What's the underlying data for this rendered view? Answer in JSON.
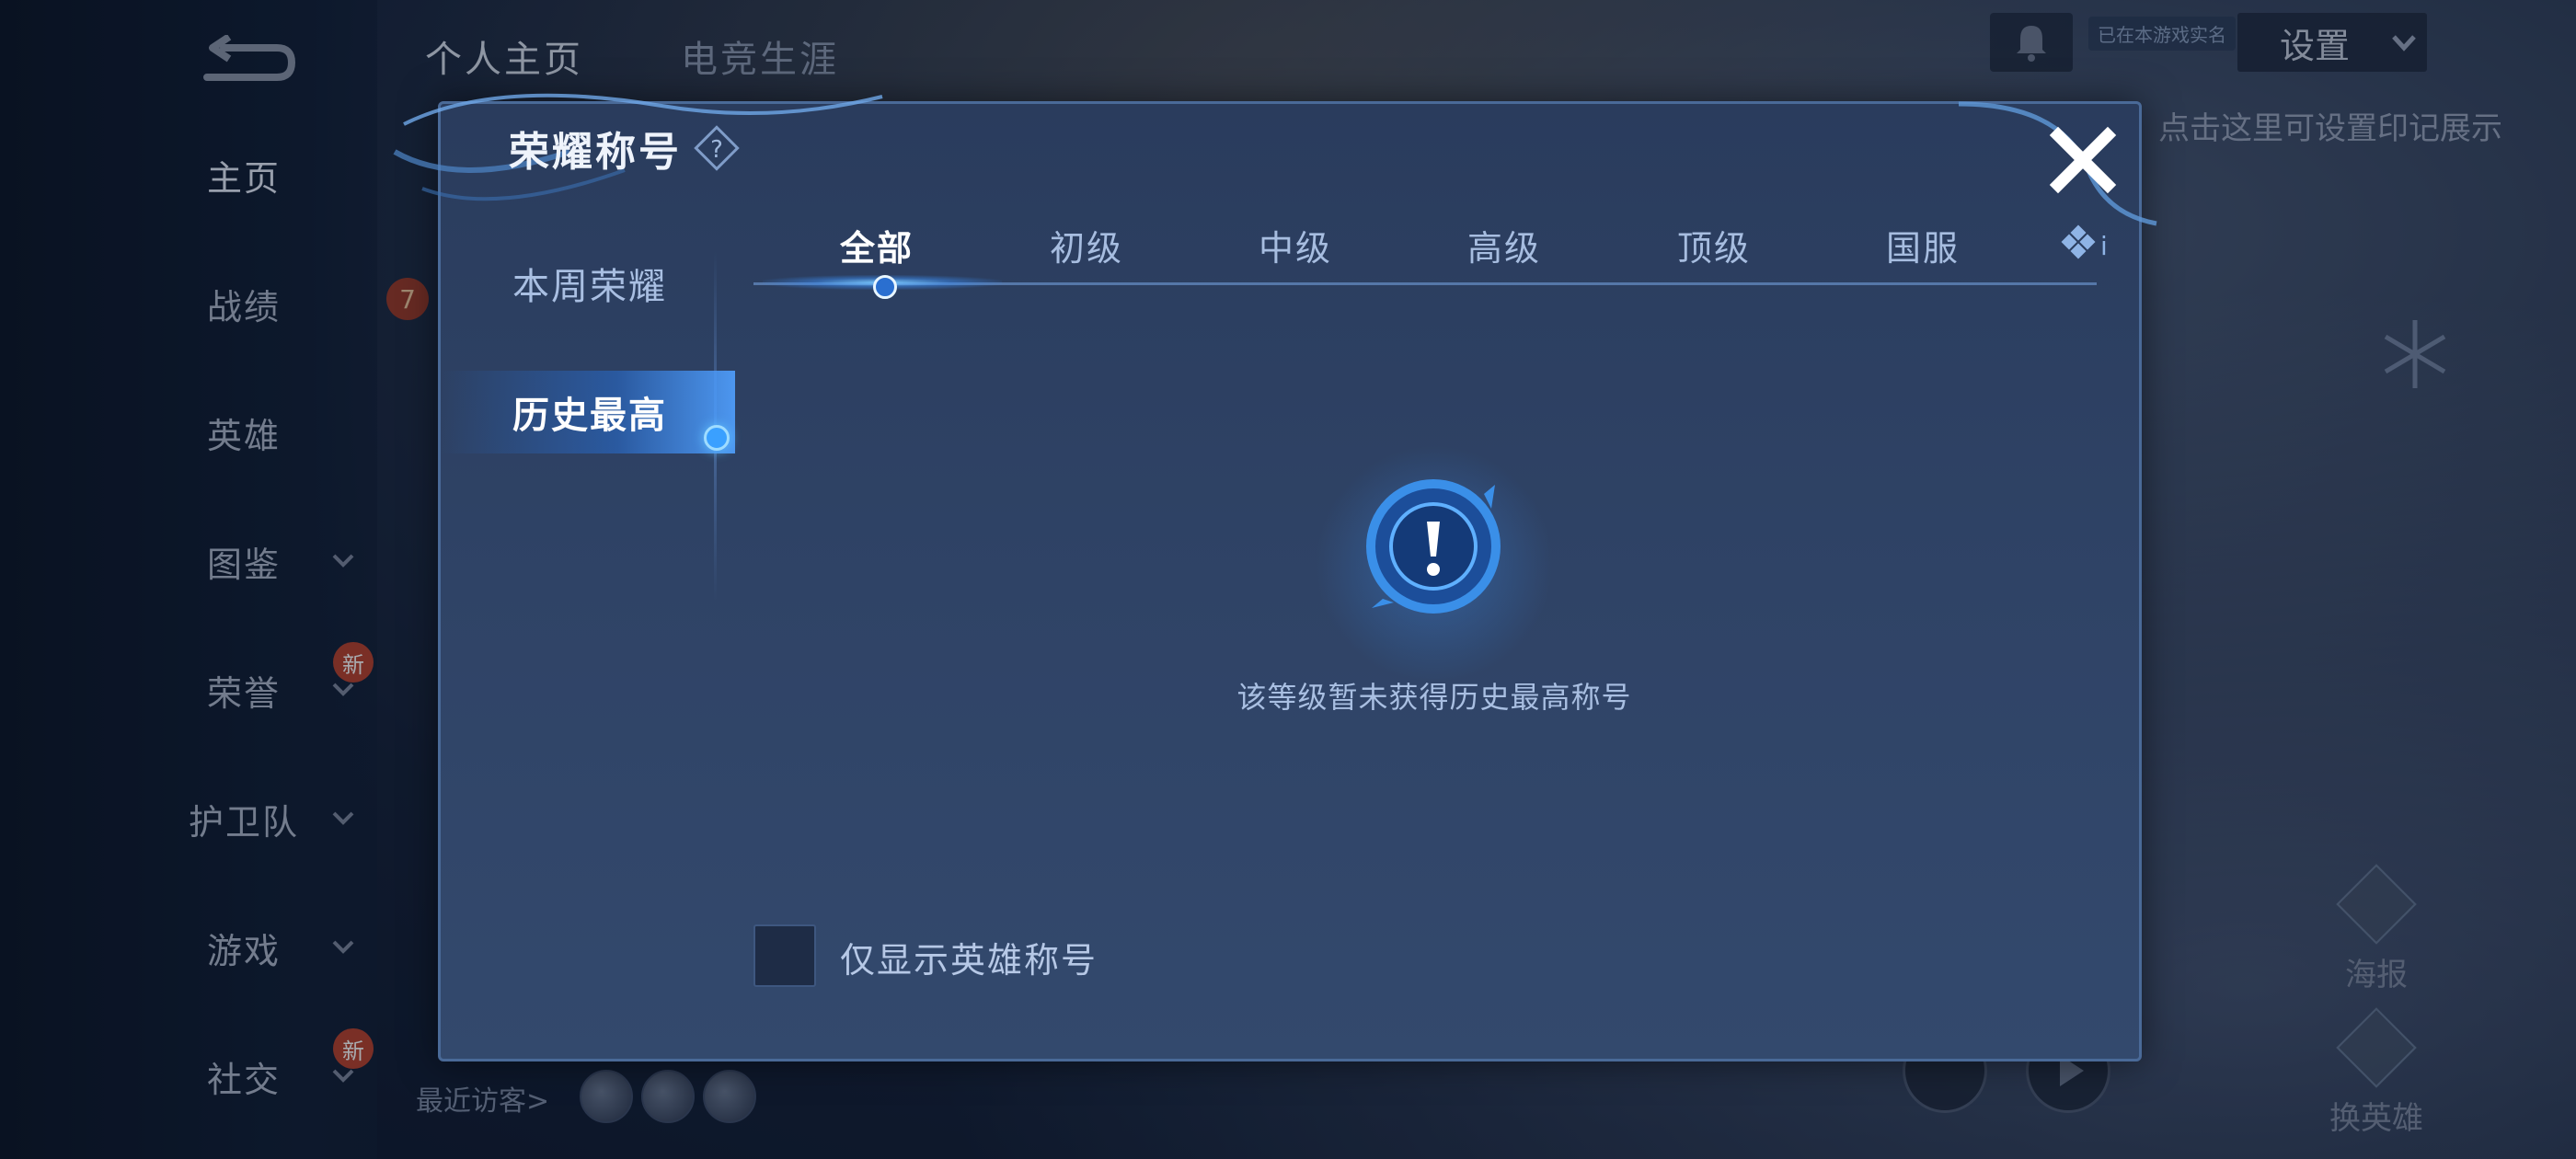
{
  "profile": {
    "tabs": [
      "个人主页",
      "电竞生涯"
    ],
    "realname_badge": "已在本游戏实名",
    "settings_label": "设置",
    "hint": "点击这里可设置印记展示",
    "recent_visitors_label": "最近访客>",
    "level_badge": "7"
  },
  "sidebar": {
    "items": [
      {
        "label": "主页",
        "active": true,
        "has_chevron": false,
        "is_new": false
      },
      {
        "label": "战绩",
        "active": false,
        "has_chevron": false,
        "is_new": false
      },
      {
        "label": "英雄",
        "active": false,
        "has_chevron": false,
        "is_new": false
      },
      {
        "label": "图鉴",
        "active": false,
        "has_chevron": true,
        "is_new": false
      },
      {
        "label": "荣誉",
        "active": false,
        "has_chevron": true,
        "is_new": true
      },
      {
        "label": "护卫队",
        "active": false,
        "has_chevron": true,
        "is_new": false
      },
      {
        "label": "游戏",
        "active": false,
        "has_chevron": true,
        "is_new": false
      },
      {
        "label": "社交",
        "active": false,
        "has_chevron": true,
        "is_new": true
      }
    ],
    "new_badge": "新"
  },
  "right_actions": {
    "poster_label": "海报",
    "swap_hero_label": "换英雄"
  },
  "modal": {
    "title": "荣耀称号",
    "categories": [
      {
        "label": "本周荣耀",
        "active": false
      },
      {
        "label": "历史最高",
        "active": true
      }
    ],
    "tabs": [
      {
        "label": "全部",
        "active": true
      },
      {
        "label": "初级",
        "active": false
      },
      {
        "label": "中级",
        "active": false
      },
      {
        "label": "高级",
        "active": false
      },
      {
        "label": "顶级",
        "active": false
      },
      {
        "label": "国服",
        "active": false
      }
    ],
    "more_tabs_glyph": "i",
    "empty_message": "该等级暂未获得历史最高称号",
    "empty_icon": "exclamation-icon",
    "filter_checkbox_label": "仅显示英雄称号",
    "filter_checked": false
  },
  "colors": {
    "accent": "#3aa0ff",
    "modal_bg": "#2f4366",
    "modal_border": "#4a6a98",
    "new_badge": "#b8432f"
  }
}
